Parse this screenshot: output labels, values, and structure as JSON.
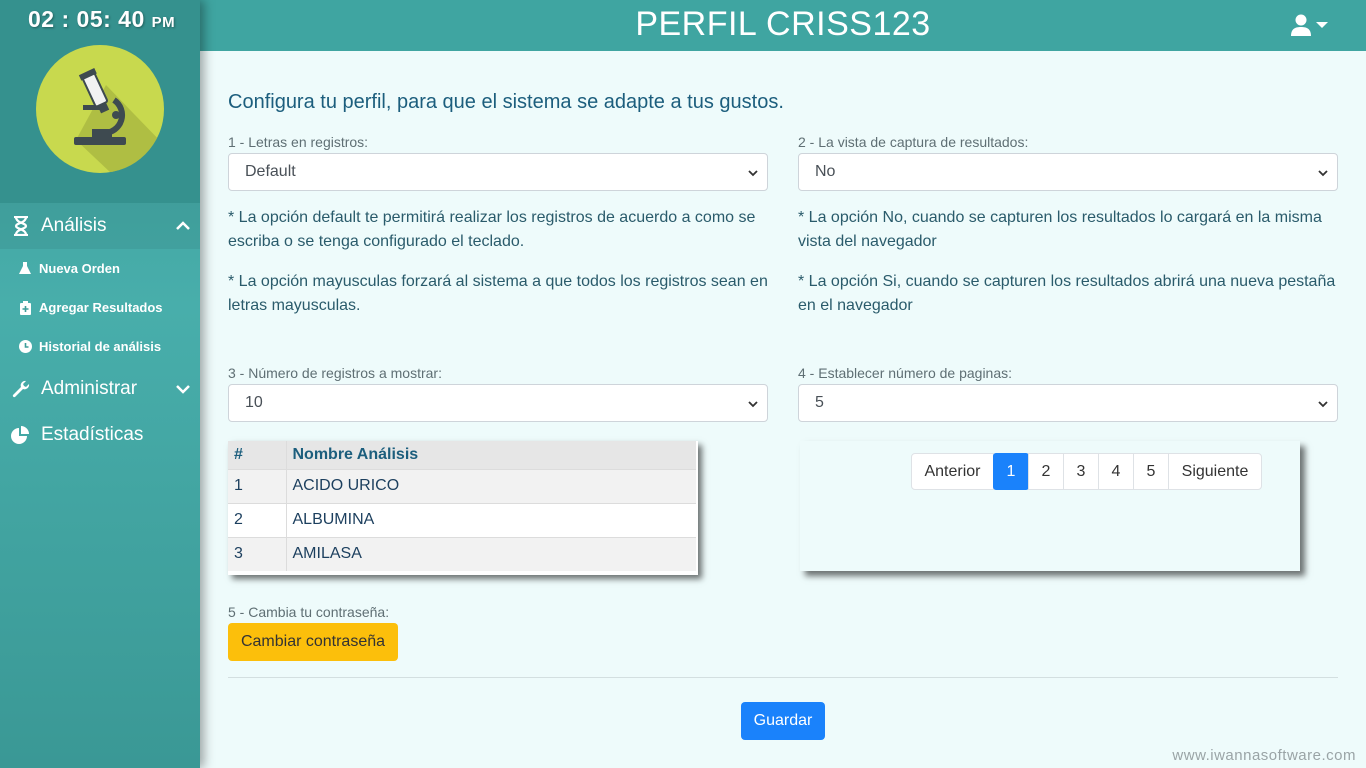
{
  "clock": {
    "time": "02 : 05: 40",
    "ampm": "PM"
  },
  "header": {
    "title": "PERFIL CRISS123",
    "user_icon": "user-icon"
  },
  "sidebar": {
    "sections": [
      {
        "label": "Análisis",
        "icon": "hourglass-icon",
        "expanded": true,
        "items": [
          {
            "label": "Nueva Orden",
            "icon": "flask-icon"
          },
          {
            "label": "Agregar Resultados",
            "icon": "clipboard-plus-icon"
          },
          {
            "label": "Historial de análisis",
            "icon": "clock-icon"
          }
        ]
      },
      {
        "label": "Administrar",
        "icon": "wrench-icon",
        "expanded": false
      },
      {
        "label": "Estadísticas",
        "icon": "pie-chart-icon"
      }
    ]
  },
  "main": {
    "intro": "Configura tu perfil, para que el sistema se adapte a tus gustos.",
    "field1": {
      "label": "1 - Letras en registros:",
      "value": "Default",
      "note1": "* La opción default te permitirá realizar los registros de acuerdo a como se escriba o se tenga configurado el teclado.",
      "note2": "* La opción mayusculas forzará al sistema a que todos los registros sean en letras mayusculas."
    },
    "field2": {
      "label": "2 - La vista de captura de resultados:",
      "value": "No",
      "note1": "* La opción No, cuando se capturen los resultados lo cargará en la misma vista del navegador",
      "note2": "* La opción Si, cuando se capturen los resultados abrirá una nueva pestaña en el navegador"
    },
    "field3": {
      "label": "3 - Número de registros a mostrar:",
      "value": "10"
    },
    "field4": {
      "label": "4 - Establecer número de paginas:",
      "value": "5"
    },
    "table": {
      "headers": [
        "#",
        "Nombre Análisis"
      ],
      "rows": [
        [
          "1",
          "ACIDO URICO"
        ],
        [
          "2",
          "ALBUMINA"
        ],
        [
          "3",
          "AMILASA"
        ]
      ]
    },
    "pagination": {
      "prev": "Anterior",
      "pages": [
        "1",
        "2",
        "3",
        "4",
        "5"
      ],
      "active": "1",
      "next": "Siguiente"
    },
    "field5": {
      "label": "5 - Cambia tu contraseña:",
      "button": "Cambiar contraseña"
    },
    "save_button": "Guardar"
  },
  "watermark": "www.iwannasoftware.com",
  "colors": {
    "primary": "#3fa5a1",
    "accent_blue": "#1a82fb",
    "accent_yellow": "#fcbf0b",
    "background": "#eefbfb"
  }
}
